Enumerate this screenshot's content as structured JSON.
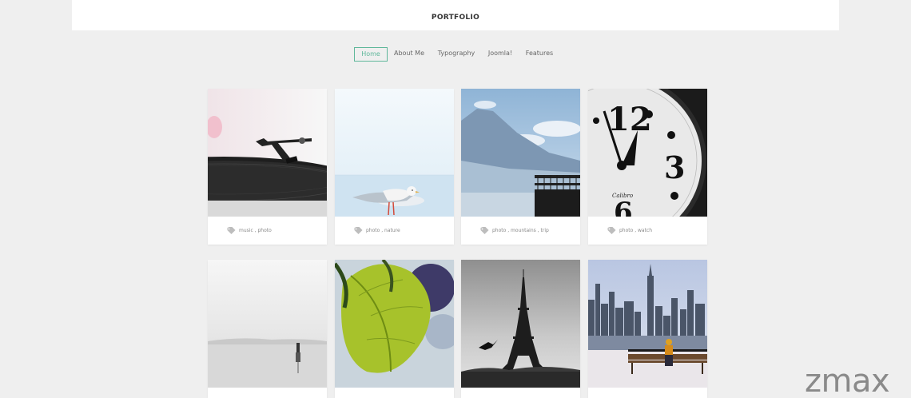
{
  "header": {
    "title": "PORTFOLIO"
  },
  "nav": {
    "items": [
      {
        "label": "Home",
        "active": true
      },
      {
        "label": "About Me"
      },
      {
        "label": "Typography"
      },
      {
        "label": "Joomla!"
      },
      {
        "label": "Features"
      }
    ]
  },
  "portfolio": {
    "row1": [
      {
        "image": "record-player",
        "tags": "music , photo"
      },
      {
        "image": "seagull",
        "tags": "photo , nature"
      },
      {
        "image": "mountains-balcony",
        "tags": "photo , mountains , trip"
      },
      {
        "image": "clock",
        "tags": "photo , watch"
      }
    ],
    "row2": [
      {
        "image": "misty-lake"
      },
      {
        "image": "green-leaf"
      },
      {
        "image": "eiffel-tower"
      },
      {
        "image": "city-skyline"
      }
    ]
  },
  "watermark": "zmax",
  "colors": {
    "accent": "#5fb79a",
    "background": "#efefef"
  }
}
